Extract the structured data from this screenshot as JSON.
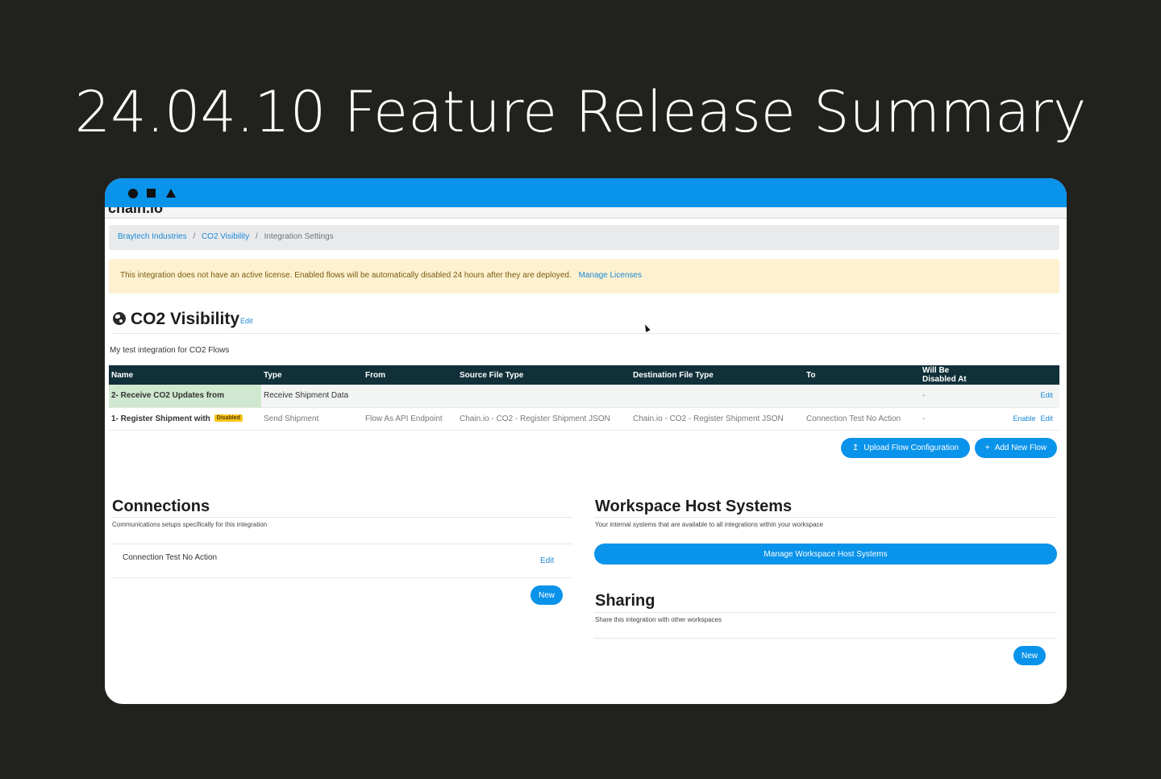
{
  "headline": "24.04.10 Feature Release Summary",
  "app": {
    "logo_text": "chain.io",
    "breadcrumb": [
      {
        "label": "Braytech Industries"
      },
      {
        "label": "CO2 Visibility"
      },
      {
        "label": "Integration Settings"
      }
    ],
    "breadcrumb_separator": "/",
    "alert": {
      "message": "This integration does not have an active license. Enabled flows will be automatically disabled 24 hours after they are deployed.",
      "link": "Manage Licenses"
    },
    "page_title": "CO2 Visibility",
    "title_edit": "Edit",
    "description": "My test integration for CO2 Flows",
    "flows": {
      "columns": [
        "Name",
        "Type",
        "From",
        "Source File Type",
        "Destination File Type",
        "To",
        "Will Be Disabled At"
      ],
      "rows": [
        {
          "name": "2- Receive CO2 Updates from",
          "badge": "",
          "type": "Receive Shipment Data",
          "from": "",
          "source": "",
          "destination": "",
          "to": "",
          "disabled_at": "-",
          "enable": "",
          "edit": "Edit"
        },
        {
          "name": "1- Register Shipment with",
          "badge": "Disabled",
          "type": "Send Shipment",
          "from": "Flow As API Endpoint",
          "source": "Chain.io - CO2 - Register Shipment JSON",
          "destination": "Chain.io - CO2 - Register Shipment JSON",
          "to": "Connection Test No Action",
          "disabled_at": "-",
          "enable": "Enable",
          "edit": "Edit"
        }
      ]
    },
    "buttons": {
      "upload": "Upload Flow Configuration",
      "add_flow": "Add New Flow"
    },
    "connections": {
      "title": "Connections",
      "subtitle": "Communications setups specifically for this integration",
      "items": [
        {
          "name": "Connection Test No Action",
          "edit": "Edit"
        }
      ],
      "new_label": "New"
    },
    "workspace_hosts": {
      "title": "Workspace Host Systems",
      "subtitle": "Your internal systems that are available to all integrations within your workspace",
      "manage_label": "Manage Workspace Host Systems"
    },
    "sharing": {
      "title": "Sharing",
      "subtitle": "Share this integration with other workspaces",
      "new_label": "New"
    }
  },
  "colors": {
    "background": "#21211e",
    "accent": "#0a93ea",
    "table_header": "#11303a",
    "alert_bg": "#fdf1d0",
    "badge": "#f6c619"
  },
  "icons": [
    "window-circle-icon",
    "window-square-icon",
    "window-triangle-icon",
    "globe-icon",
    "upload-icon",
    "plus-icon",
    "mouse-cursor-icon"
  ]
}
